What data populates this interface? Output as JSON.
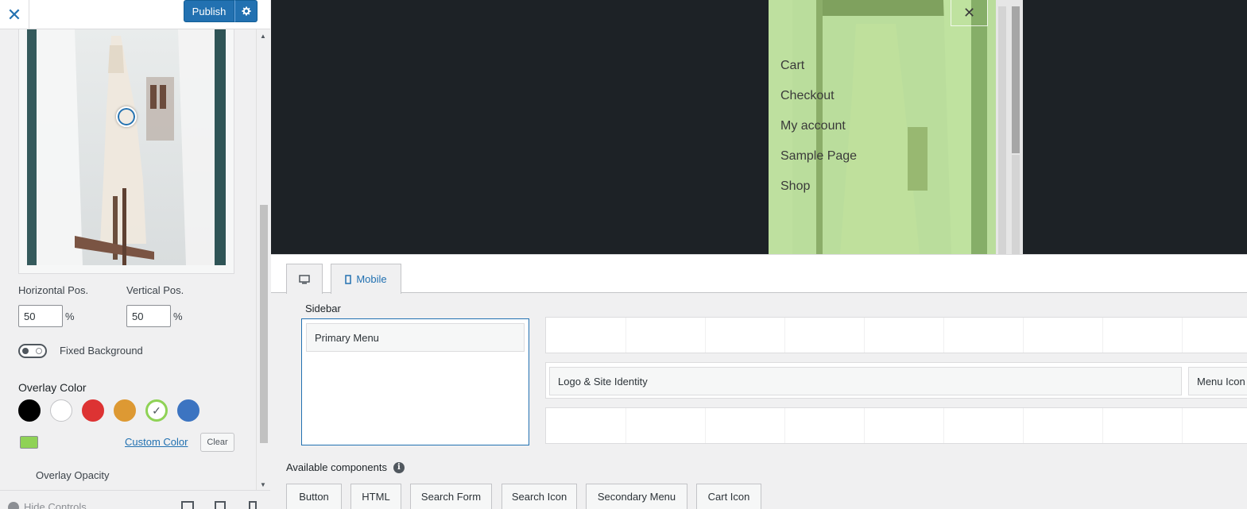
{
  "header": {
    "close_icon": "close-icon",
    "publish_label": "Publish",
    "gear_icon": "gear-icon"
  },
  "background": {
    "horizontal_label": "Horizontal Pos.",
    "horizontal_value": "50",
    "vertical_label": "Vertical Pos.",
    "vertical_value": "50",
    "unit": "%",
    "fixed_label": "Fixed Background",
    "fixed_on": false
  },
  "overlay": {
    "label": "Overlay Color",
    "swatches": [
      "#000000",
      "#ffffff",
      "#dd3333",
      "#dd9933",
      "#8fd256",
      "#3c74c1"
    ],
    "selected_color": "#8fd256",
    "custom_color_label": "Custom Color",
    "clear_label": "Clear",
    "opacity_label": "Overlay Opacity"
  },
  "footer": {
    "hide_controls_label": "Hide Controls"
  },
  "preview": {
    "menu_items": [
      "Cart",
      "Checkout",
      "My account",
      "Sample Page",
      "Shop"
    ],
    "close_icon": "close-icon"
  },
  "builder": {
    "tabs": [
      {
        "label": "",
        "icon": "desktop-icon"
      },
      {
        "label": "Mobile",
        "icon": "mobile-icon"
      }
    ],
    "sidebar_label": "Sidebar",
    "sidebar_items": [
      "Primary Menu"
    ],
    "middle_row_items": [
      "Logo & Site Identity",
      "Menu Icon"
    ],
    "available_label": "Available components",
    "components": [
      "Button",
      "HTML",
      "Search Form",
      "Search Icon",
      "Secondary Menu",
      "Cart Icon"
    ]
  }
}
